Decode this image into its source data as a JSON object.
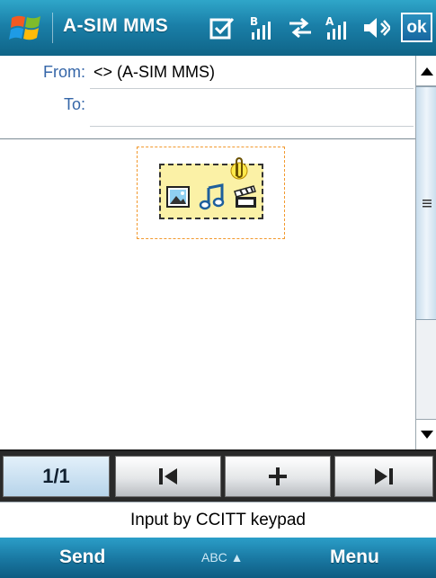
{
  "titlebar": {
    "title": "A-SIM MMS",
    "ok_label": "ok",
    "icons": [
      "start-flag-icon",
      "notification-icon",
      "signal-icon",
      "data-transfer-icon",
      "signal-icon",
      "volume-icon"
    ]
  },
  "header": {
    "from_label": "From:",
    "from_value": "<> (A-SIM MMS)",
    "to_label": "To:",
    "to_value": ""
  },
  "content": {
    "attachment_icons": [
      "picture-icon",
      "music-icon",
      "video-clapper-icon",
      "paperclip-icon"
    ]
  },
  "toolbar": {
    "page_indicator": "1/1",
    "buttons": [
      "previous-slide-icon",
      "add-slide-icon",
      "next-slide-icon"
    ]
  },
  "input_status": "Input by CCITT keypad",
  "softkeys": {
    "left": "Send",
    "sip": "ABC ▲",
    "right": "Menu"
  },
  "colors": {
    "titlebar": "#1a7fa8",
    "label_blue": "#3566a8",
    "placeholder_border": "#f2992e",
    "media_fill": "#fbf1a6"
  }
}
